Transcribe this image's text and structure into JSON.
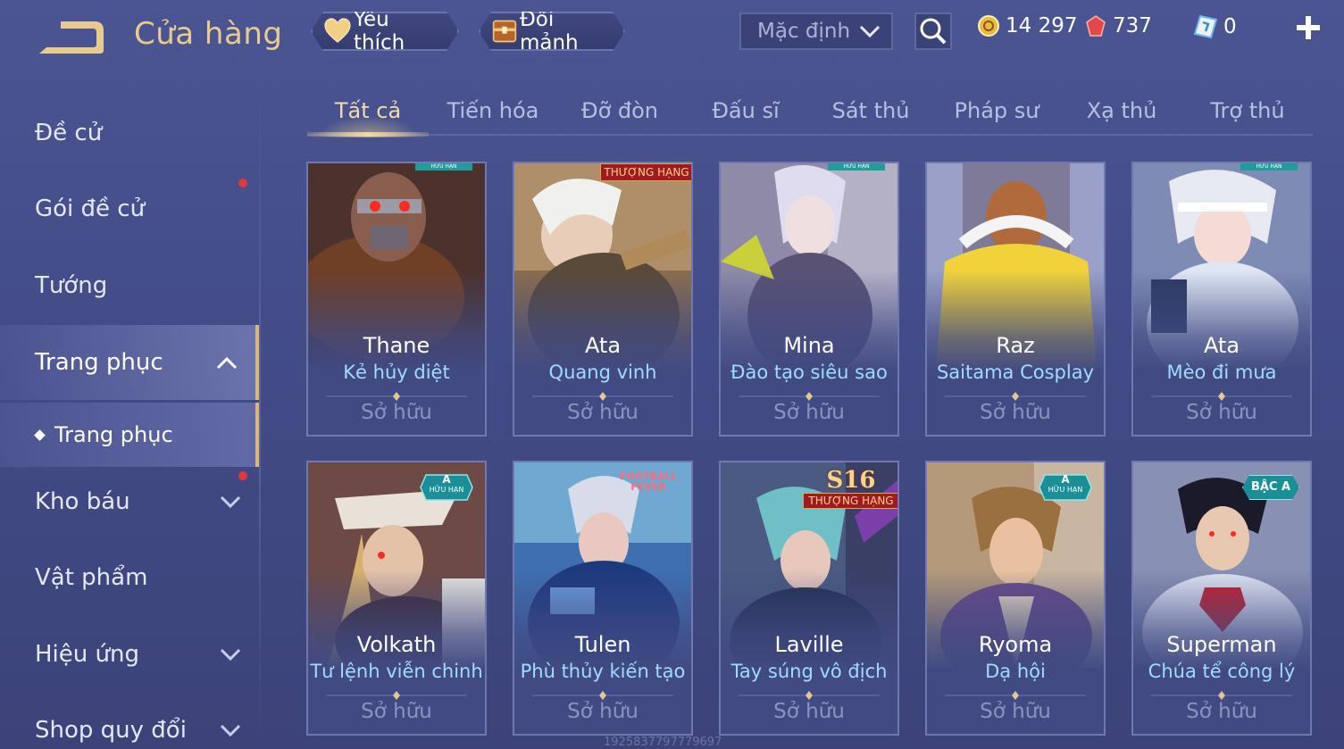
{
  "header": {
    "title": "Cửa hàng",
    "favorite_label": "Yêu thích",
    "exchange_label": "Đổi mảnh",
    "sort_value": "Mặc định",
    "gold": "14 297",
    "ruby": "737",
    "voucher": "0"
  },
  "sidebar": {
    "items": [
      {
        "label": "Đề cử"
      },
      {
        "label": "Gói đề cử"
      },
      {
        "label": "Tướng"
      },
      {
        "label": "Trang phục"
      },
      {
        "label": "Trang phục"
      },
      {
        "label": "Kho báu"
      },
      {
        "label": "Vật phẩm"
      },
      {
        "label": "Hiệu ứng"
      },
      {
        "label": "Shop quy đổi"
      }
    ]
  },
  "tabs": [
    {
      "label": "Tất cả"
    },
    {
      "label": "Tiến hóa"
    },
    {
      "label": "Đỡ đòn"
    },
    {
      "label": "Đấu sĩ"
    },
    {
      "label": "Sát thủ"
    },
    {
      "label": "Pháp sư"
    },
    {
      "label": "Xạ thủ"
    },
    {
      "label": "Trợ thủ"
    }
  ],
  "cards": [
    {
      "hero": "Thane",
      "skin": "Kẻ hủy diệt",
      "status": "Sở hữu",
      "badge": "HỮU HẠN"
    },
    {
      "hero": "Ata",
      "skin": "Quang vinh",
      "status": "Sở hữu",
      "badge": "THƯỢNG HẠNG"
    },
    {
      "hero": "Mina",
      "skin": "Đào tạo siêu sao",
      "status": "Sở hữu",
      "badge": "HỮU HẠN"
    },
    {
      "hero": "Raz",
      "skin": "Saitama Cosplay",
      "status": "Sở hữu",
      "badge": ""
    },
    {
      "hero": "Ata",
      "skin": "Mèo đi mưa",
      "status": "Sở hữu",
      "badge": "HỮU HẠN"
    },
    {
      "hero": "Volkath",
      "skin": "Tư lệnh viễn chinh",
      "status": "Sở hữu",
      "badge": "A",
      "badge_sub": "HỮU HẠN"
    },
    {
      "hero": "Tulen",
      "skin": "Phù thủy kiến tạo",
      "status": "Sở hữu",
      "badge": "FOOTBALL FEVER"
    },
    {
      "hero": "Laville",
      "skin": "Tay súng vô địch",
      "status": "Sở hữu",
      "badge": "S16",
      "badge_sub": "THƯỢNG HẠNG"
    },
    {
      "hero": "Ryoma",
      "skin": "Dạ hội",
      "status": "Sở hữu",
      "badge": "A",
      "badge_sub": "HỮU HẠN"
    },
    {
      "hero": "Superman",
      "skin": "Chúa tể công lý",
      "status": "Sở hữu",
      "badge": "BẬC A"
    }
  ],
  "watermark": "1925837797779697",
  "colors": {
    "accent_gold": "#e8c98e",
    "skin_name": "#9fdcff",
    "notify_red": "#e0383c"
  }
}
